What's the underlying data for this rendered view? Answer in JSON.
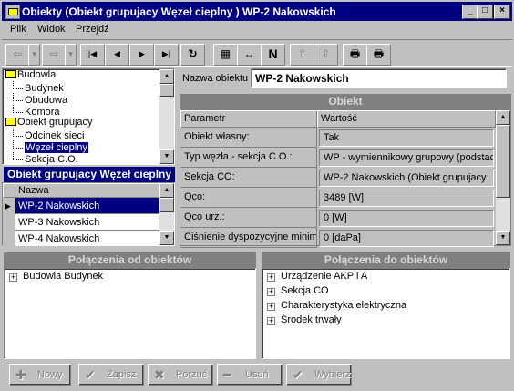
{
  "window": {
    "title": "Obiekty  (Obiekt grupujacy Węzeł cieplny ) WP-2 Nakowskich",
    "min": "_",
    "max": "□",
    "close": "×"
  },
  "menu": [
    {
      "label": "Plik"
    },
    {
      "label": "Widok"
    },
    {
      "label": "Przejdź"
    }
  ],
  "toolbar": {
    "back": "⇦",
    "forward": "⇨",
    "dropdown": "▾",
    "first": "|◀",
    "prev": "◀",
    "next": "▶",
    "last": "▶|",
    "refresh": "↻",
    "grid": "▦",
    "fit": "↔",
    "n": "N",
    "pin1": "⇧",
    "pin2": "⇧",
    "print_preview": "🖶",
    "print": "🖶"
  },
  "tree": {
    "items": [
      {
        "label": "Budowla",
        "level": 0,
        "type": "folder"
      },
      {
        "label": "Budynek",
        "level": 1,
        "type": "twig"
      },
      {
        "label": "Obudowa",
        "level": 1,
        "type": "twig"
      },
      {
        "label": "Komora",
        "level": 1,
        "type": "twig"
      },
      {
        "label": "Obiekt grupujacy",
        "level": 0,
        "type": "folder"
      },
      {
        "label": "Odcinek sieci",
        "level": 1,
        "type": "twig"
      },
      {
        "label": "Węzeł cieplny",
        "level": 1,
        "type": "twig",
        "selected": true
      },
      {
        "label": "Sekcja C.O.",
        "level": 1,
        "type": "twig"
      }
    ]
  },
  "list": {
    "title": "Obiekt grupujacy Węzeł cieplny",
    "column": "Nazwa",
    "rows": [
      "WP-2 Nakowskich",
      "WP-3 Nakowskich",
      "WP-4 Nakowskich"
    ],
    "selected": 0
  },
  "details": {
    "name_label": "Nazwa obiektu",
    "name_value": "WP-2 Nakowskich",
    "section_title": "Obiekt",
    "col_param": "Parametr",
    "col_value": "Wartość",
    "rows": [
      {
        "param": "Obiekt własny:",
        "value": "Tak"
      },
      {
        "param": "Typ węzła - sekcja C.O.:",
        "value": "WP - wymiennikowy grupowy (podstacja)"
      },
      {
        "param": "Sekcja CO:",
        "value": "WP-2 Nakowskich (Obiekt grupujacy"
      },
      {
        "param": "Qco:",
        "value": "3489 [W]"
      },
      {
        "param": "Qco urz.:",
        "value": "0 [W]"
      },
      {
        "param": "Ciśnienie dyspozycyjne minimalne:",
        "value": "0 [daPa]"
      }
    ]
  },
  "connections_from": {
    "title": "Połączenia od obiektów",
    "items": [
      "Budowla Budynek"
    ]
  },
  "connections_to": {
    "title": "Połączenia do obiektów",
    "items": [
      "Urządzenie AKP i A",
      "Sekcja CO",
      "Charakterystyka elektryczna",
      "Środek trwały"
    ]
  },
  "buttons": [
    {
      "label": "Nowy",
      "icon": "✚"
    },
    {
      "label": "Zapisz",
      "icon": "✔"
    },
    {
      "label": "Porzuć",
      "icon": "✖"
    },
    {
      "label": "Usuń",
      "icon": "━"
    },
    {
      "label": "Wybierz",
      "icon": "✔"
    }
  ]
}
